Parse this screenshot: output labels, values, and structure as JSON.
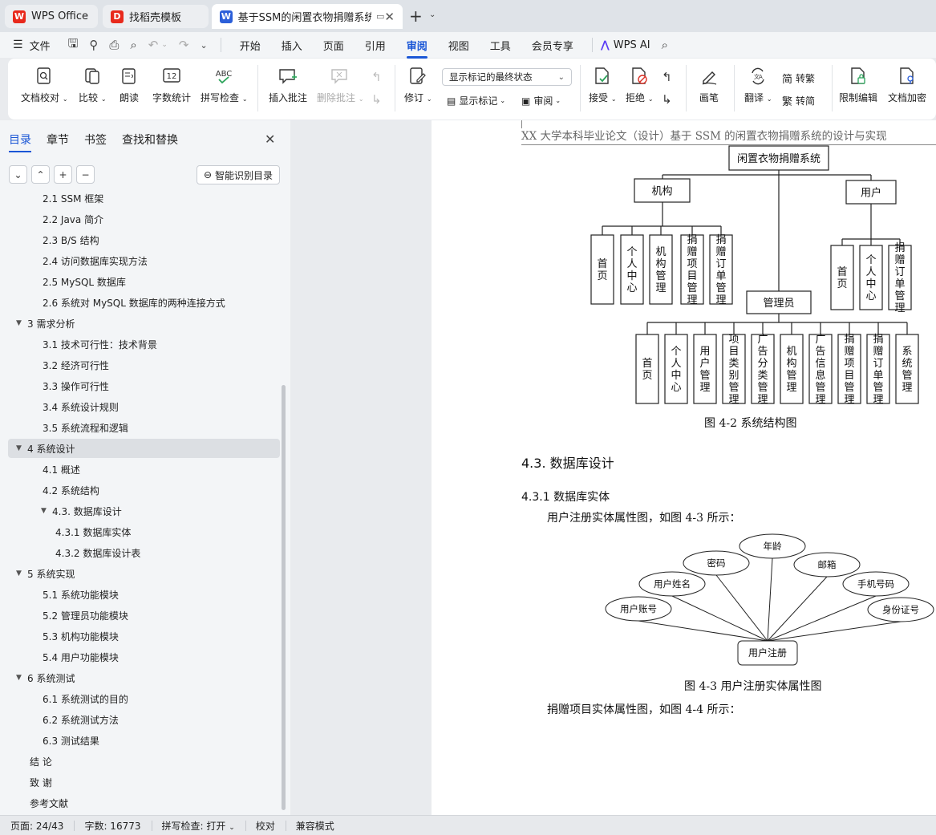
{
  "tabs": [
    {
      "label": "WPS Office",
      "logo": "W",
      "color": "#e8291c"
    },
    {
      "label": "找稻壳模板",
      "logo": "D",
      "color": "#e8291c"
    },
    {
      "label": "基于SSM的闲置衣物捐赠系统",
      "logo": "W",
      "color": "#2b5fd9"
    }
  ],
  "menubar": {
    "file": "文件",
    "items": [
      "开始",
      "插入",
      "页面",
      "引用",
      "审阅",
      "视图",
      "工具",
      "会员专享"
    ],
    "active": "审阅",
    "wps_ai": "WPS AI"
  },
  "ribbon": {
    "doc_check": "文档校对",
    "compare": "比较",
    "read_aloud": "朗读",
    "word_count": "字数统计",
    "spell_check": "拼写检查",
    "insert_comment": "插入批注",
    "delete_comment": "删除批注",
    "revise": "修订",
    "show_mode": "显示标记的最终状态",
    "show_markup": "显示标记",
    "review": "审阅",
    "accept": "接受",
    "reject": "拒绝",
    "pen": "画笔",
    "translate": "翻译",
    "to_traditional": "转繁",
    "to_simplified": "转简",
    "restrict_edit": "限制编辑",
    "encrypt": "文档加密",
    "abc": "ABC",
    "count_num": "12"
  },
  "nav": {
    "tabs": [
      "目录",
      "章节",
      "书签",
      "查找和替换"
    ],
    "smart_toc": "智能识别目录",
    "toc": [
      {
        "label": "2.1 SSM 框架",
        "level": 2
      },
      {
        "label": "2.2 Java 简介",
        "level": 2
      },
      {
        "label": "2.3 B/S 结构",
        "level": 2
      },
      {
        "label": "2.4 访问数据库实现方法",
        "level": 2
      },
      {
        "label": "2.5 MySQL 数据库",
        "level": 2
      },
      {
        "label": "2.6 系统对 MySQL 数据库的两种连接方式",
        "level": 2
      },
      {
        "label": "3  需求分析",
        "level": 1
      },
      {
        "label": "3.1 技术可行性：技术背景",
        "level": 2
      },
      {
        "label": "3.2 经济可行性",
        "level": 2
      },
      {
        "label": "3.3 操作可行性",
        "level": 2
      },
      {
        "label": "3.4 系统设计规则",
        "level": 2
      },
      {
        "label": "3.5 系统流程和逻辑",
        "level": 2
      },
      {
        "label": "4  系统设计",
        "level": 1
      },
      {
        "label": "4.1  概述",
        "level": 2
      },
      {
        "label": "4.2  系统结构",
        "level": 2
      },
      {
        "label": "4.3.  数据库设计",
        "level": 2
      },
      {
        "label": "4.3.1  数据库实体",
        "level": 3
      },
      {
        "label": "4.3.2  数据库设计表",
        "level": 3
      },
      {
        "label": "5  系统实现",
        "level": 1
      },
      {
        "label": "5.1 系统功能模块",
        "level": 2
      },
      {
        "label": "5.2 管理员功能模块",
        "level": 2
      },
      {
        "label": "5.3 机构功能模块",
        "level": 2
      },
      {
        "label": "5.4 用户功能模块",
        "level": 2
      },
      {
        "label": "6  系统测试",
        "level": 1
      },
      {
        "label": "6.1 系统测试的目的",
        "level": 2
      },
      {
        "label": "6.2 系统测试方法",
        "level": 2
      },
      {
        "label": "6.3  测试结果",
        "level": 2
      },
      {
        "label": "结   论",
        "level": 1
      },
      {
        "label": "致   谢",
        "level": 1
      },
      {
        "label": "参考文献",
        "level": 1
      }
    ]
  },
  "document": {
    "header": "XX 大学本科毕业论文（设计）基于 SSM 的闲置衣物捐赠系统的设计与实现",
    "fig42": {
      "root": "闲置衣物捐赠系统",
      "org": "机构",
      "user": "用户",
      "admin": "管理员",
      "org_items": [
        "首页",
        "个人中心",
        "机构管理",
        "捐赠项目管理",
        "捐赠订单管理"
      ],
      "user_items": [
        "首页",
        "个人中心",
        "捐赠订单管理"
      ],
      "admin_items": [
        "首页",
        "个人中心",
        "用户管理",
        "项目类别管理",
        "广告分类管理",
        "机构管理",
        "广告信息管理",
        "捐赠项目管理",
        "捐赠订单管理",
        "系统管理"
      ],
      "caption": "图 4-2  系统结构图"
    },
    "section_43": "4.3.  数据库设计",
    "section_431": "4.3.1  数据库实体",
    "para1": "用户注册实体属性图，如图 4-3 所示：",
    "fig43": {
      "center": "用户注册",
      "attrs": [
        "用户账号",
        "用户姓名",
        "密码",
        "年龄",
        "邮箱",
        "手机号码",
        "身份证号"
      ],
      "caption": "图 4-3 用户注册实体属性图"
    },
    "para2": "捐赠项目实体属性图，如图 4-4 所示："
  },
  "status": {
    "page": "页面: 24/43",
    "words": "字数: 16773",
    "spell": "拼写检查: 打开",
    "proof": "校对",
    "compat": "兼容模式"
  }
}
